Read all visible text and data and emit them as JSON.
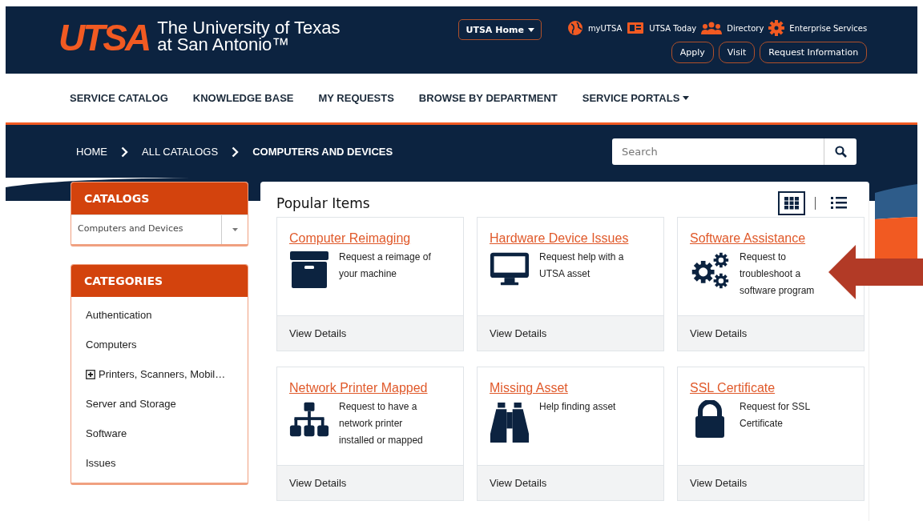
{
  "header": {
    "logo": "UTSA",
    "university_name": [
      "The University of Texas",
      "at San Antonio™"
    ],
    "home_menu": "UTSA Home",
    "quick_links": [
      "myUTSA",
      "UTSA Today",
      "Directory",
      "Enterprise Services"
    ],
    "buttons": [
      "Apply",
      "Visit",
      "Request Information"
    ]
  },
  "nav": {
    "items": [
      {
        "label": "SERVICE CATALOG",
        "dropdown": false
      },
      {
        "label": "KNOWLEDGE BASE",
        "dropdown": false
      },
      {
        "label": "MY REQUESTS",
        "dropdown": false
      },
      {
        "label": "BROWSE BY DEPARTMENT",
        "dropdown": false
      },
      {
        "label": "SERVICE PORTALS",
        "dropdown": true
      }
    ]
  },
  "breadcrumbs": [
    "HOME",
    "ALL CATALOGS",
    "COMPUTERS AND DEVICES"
  ],
  "search": {
    "placeholder": "Search"
  },
  "catalogs": {
    "title": "CATALOGS",
    "value": "Computers and Devices"
  },
  "categories": {
    "title": "CATEGORIES",
    "items": [
      {
        "label": "Authentication",
        "kind": "leaf"
      },
      {
        "label": "Computers",
        "kind": "leaf"
      },
      {
        "label": "Printers, Scanners, Mobil…",
        "kind": "group"
      },
      {
        "label": "Server and Storage",
        "kind": "leaf"
      },
      {
        "label": "Software",
        "kind": "leaf"
      },
      {
        "label": "Issues",
        "kind": "leaf"
      }
    ]
  },
  "popular": {
    "title": "Popular Items",
    "view_toggle": [
      {
        "selected": true
      },
      {
        "selected": false
      }
    ],
    "items": [
      {
        "title": "Computer Reimaging",
        "description": "Request a reimage of your machine",
        "action": "View Details"
      },
      {
        "title": "Hardware Device Issues",
        "description": "Request help with a UTSA asset",
        "action": "View Details"
      },
      {
        "title": "Software Assistance",
        "description": "Request to troubleshoot a software program",
        "action": "View Details"
      },
      {
        "title": "Network Printer Mapped",
        "description": "Request to have a network printer installed or mapped",
        "action": "View Details"
      },
      {
        "title": "Missing Asset",
        "description": "Help finding asset",
        "action": "View Details"
      },
      {
        "title": "SSL Certificate",
        "description": "Request for SSL Certificate",
        "action": "View Details"
      }
    ]
  }
}
